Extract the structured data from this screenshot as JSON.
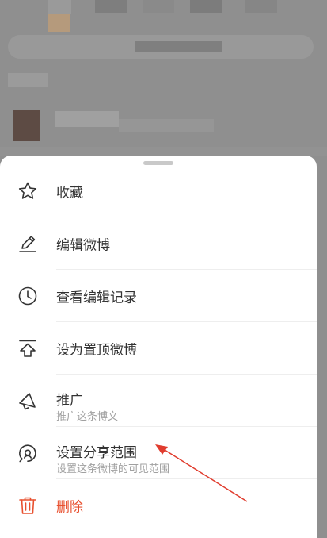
{
  "menu": {
    "items": [
      {
        "label": "收藏",
        "icon": "star-icon"
      },
      {
        "label": "编辑微博",
        "icon": "pencil-icon"
      },
      {
        "label": "查看编辑记录",
        "icon": "clock-icon"
      },
      {
        "label": "设为置顶微博",
        "icon": "pin-top-icon"
      },
      {
        "label": "推广",
        "sublabel": "推广这条博文",
        "icon": "megaphone-icon"
      },
      {
        "label": "设置分享范围",
        "sublabel": "设置这条微博的可见范围",
        "icon": "share-scope-icon"
      },
      {
        "label": "删除",
        "icon": "trash-icon",
        "color": "#e8502f"
      }
    ]
  },
  "colors": {
    "text": "#333333",
    "subtext": "#a0a0a0",
    "danger": "#e8502f",
    "overlay": "#8f8f8f",
    "annotation_arrow": "#e03c2e"
  }
}
